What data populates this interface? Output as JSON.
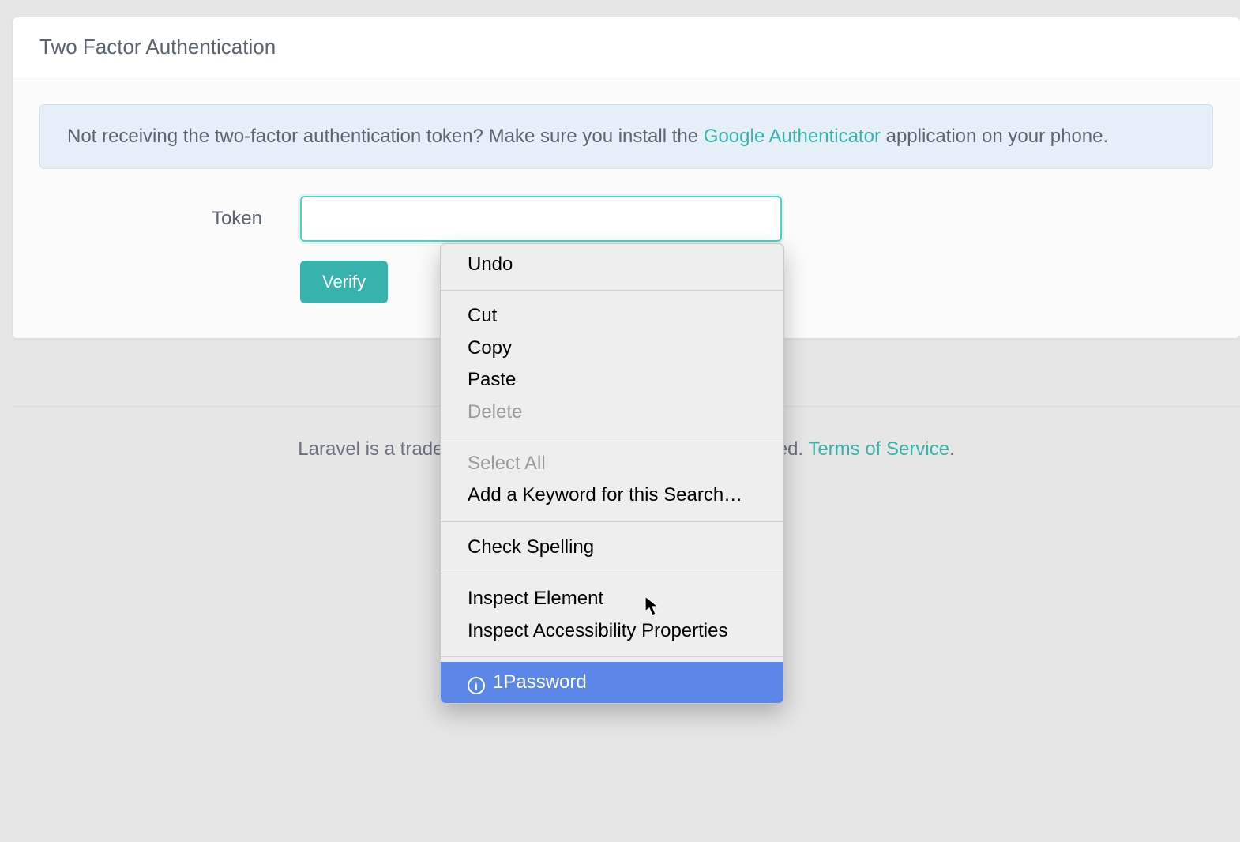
{
  "card": {
    "title": "Two Factor Authentication"
  },
  "alert": {
    "pre": "Not receiving the two-factor authentication token? Make sure you install the ",
    "link": "Google Authenticator",
    "post": " application on your phone."
  },
  "form": {
    "token_label": "Token",
    "token_value": "",
    "verify_label": "Verify"
  },
  "footer": {
    "pre": "Laravel is a trademark of Taylor Otwell",
    "mid_obscured": "ved. ",
    "tos": "Terms of Service",
    "period": "."
  },
  "context_menu": {
    "groups": [
      [
        {
          "label": "Undo",
          "enabled": true
        }
      ],
      [
        {
          "label": "Cut",
          "enabled": true
        },
        {
          "label": "Copy",
          "enabled": true
        },
        {
          "label": "Paste",
          "enabled": true
        },
        {
          "label": "Delete",
          "enabled": false
        }
      ],
      [
        {
          "label": "Select All",
          "enabled": false
        },
        {
          "label": "Add a Keyword for this Search…",
          "enabled": true
        }
      ],
      [
        {
          "label": "Check Spelling",
          "enabled": true
        }
      ],
      [
        {
          "label": "Inspect Element",
          "enabled": true
        },
        {
          "label": "Inspect Accessibility Properties",
          "enabled": true
        }
      ],
      [
        {
          "label": "1Password",
          "enabled": true,
          "icon": "1password-icon",
          "selected": true
        }
      ]
    ]
  }
}
